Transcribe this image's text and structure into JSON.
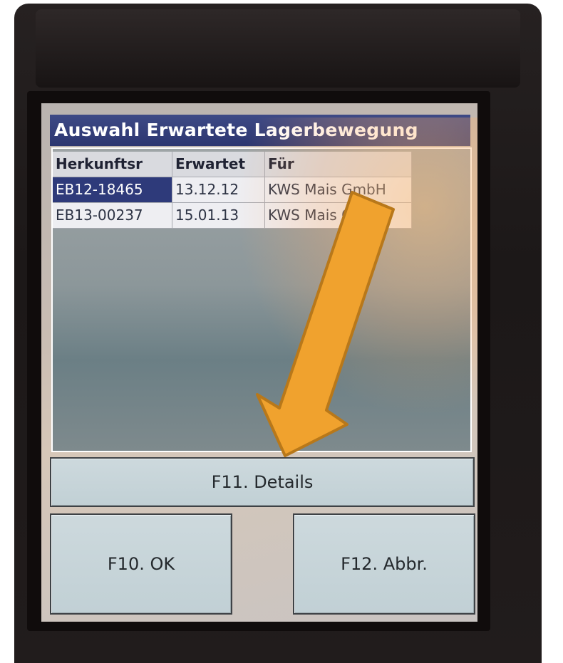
{
  "window": {
    "title": "Auswahl Erwartete Lagerbewegung"
  },
  "grid": {
    "columns": [
      "Herkunftsr",
      "Erwartet",
      "Für"
    ],
    "rows": [
      [
        "EB12-18465",
        "13.12.12",
        "KWS Mais GmbH"
      ],
      [
        "EB13-00237",
        "15.01.13",
        "KWS Mais GmbH"
      ]
    ],
    "selected_row": 0
  },
  "buttons": {
    "details": "F11. Details",
    "ok": "F10. OK",
    "cancel": "F12. Abbr."
  },
  "annotation": {
    "arrow_color": "#f0a22e",
    "arrow_outline": "#b8781a"
  }
}
